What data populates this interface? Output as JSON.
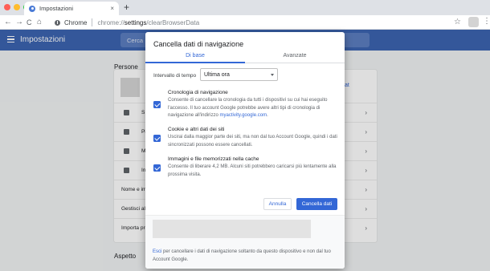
{
  "window": {
    "tab_title": "Impostazioni",
    "new_tab": "+",
    "tab_close": "×",
    "traffic_lights": [
      "#ff5f57",
      "#febc2e",
      "#28c840"
    ]
  },
  "toolbar": {
    "back": "←",
    "forward": "→",
    "reload": "C",
    "home": "⌂",
    "scheme_label": "Chrome",
    "url_scheme": "chrome://",
    "url_host": "settings",
    "url_path": "/clearBrowserData",
    "star": "☆",
    "menu": "⋮"
  },
  "settings": {
    "app_title": "Impostazioni",
    "search_placeholder": "Cerca",
    "section_people": "Persone",
    "sync_button": "ttivat",
    "rows": [
      {
        "label": "S"
      },
      {
        "label": "Pi"
      },
      {
        "label": "M"
      },
      {
        "label": "In"
      },
      {
        "label": "Nome e im"
      },
      {
        "label": "Gestisci alt"
      },
      {
        "label": "Importa pre"
      }
    ],
    "section_appearance": "Aspetto"
  },
  "dialog": {
    "title": "Cancella dati di navigazione",
    "tabs": [
      {
        "label": "Di base",
        "active": true
      },
      {
        "label": "Avanzate",
        "active": false
      }
    ],
    "time_range": {
      "label": "Intervallo di tempo",
      "value": "Ultima ora"
    },
    "options": [
      {
        "title": "Cronologia di navigazione",
        "desc": "Consente di cancellare la cronologia da tutti i dispositivi su cui hai eseguito l'accesso. Il tuo account Google potrebbe avere altri tipi di cronologia di navigazione all'indirizzo",
        "link": "myactivity.google.com",
        "after": ".",
        "checked": true
      },
      {
        "title": "Cookie e altri dati dei siti",
        "desc": "Uscirai dalla maggior parte dei siti, ma non dal tuo Account Google, quindi i dati sincronizzati possono essere cancellati.",
        "checked": true
      },
      {
        "title": "Immagini e file memorizzati nella cache",
        "desc": "Consente di liberare 4,2 MB. Alcuni siti potrebbero caricarsi più lentamente alla prossima visita.",
        "checked": true
      }
    ],
    "cancel_label": "Annulla",
    "confirm_label": "Cancella dati",
    "footer": {
      "link": "Esci",
      "text": " per cancellare i dati di navigazione soltanto da questo dispositivo e non dal tuo Account Google."
    }
  },
  "colors": {
    "accent": "#3367d6",
    "appbar": "#3c64b1"
  }
}
